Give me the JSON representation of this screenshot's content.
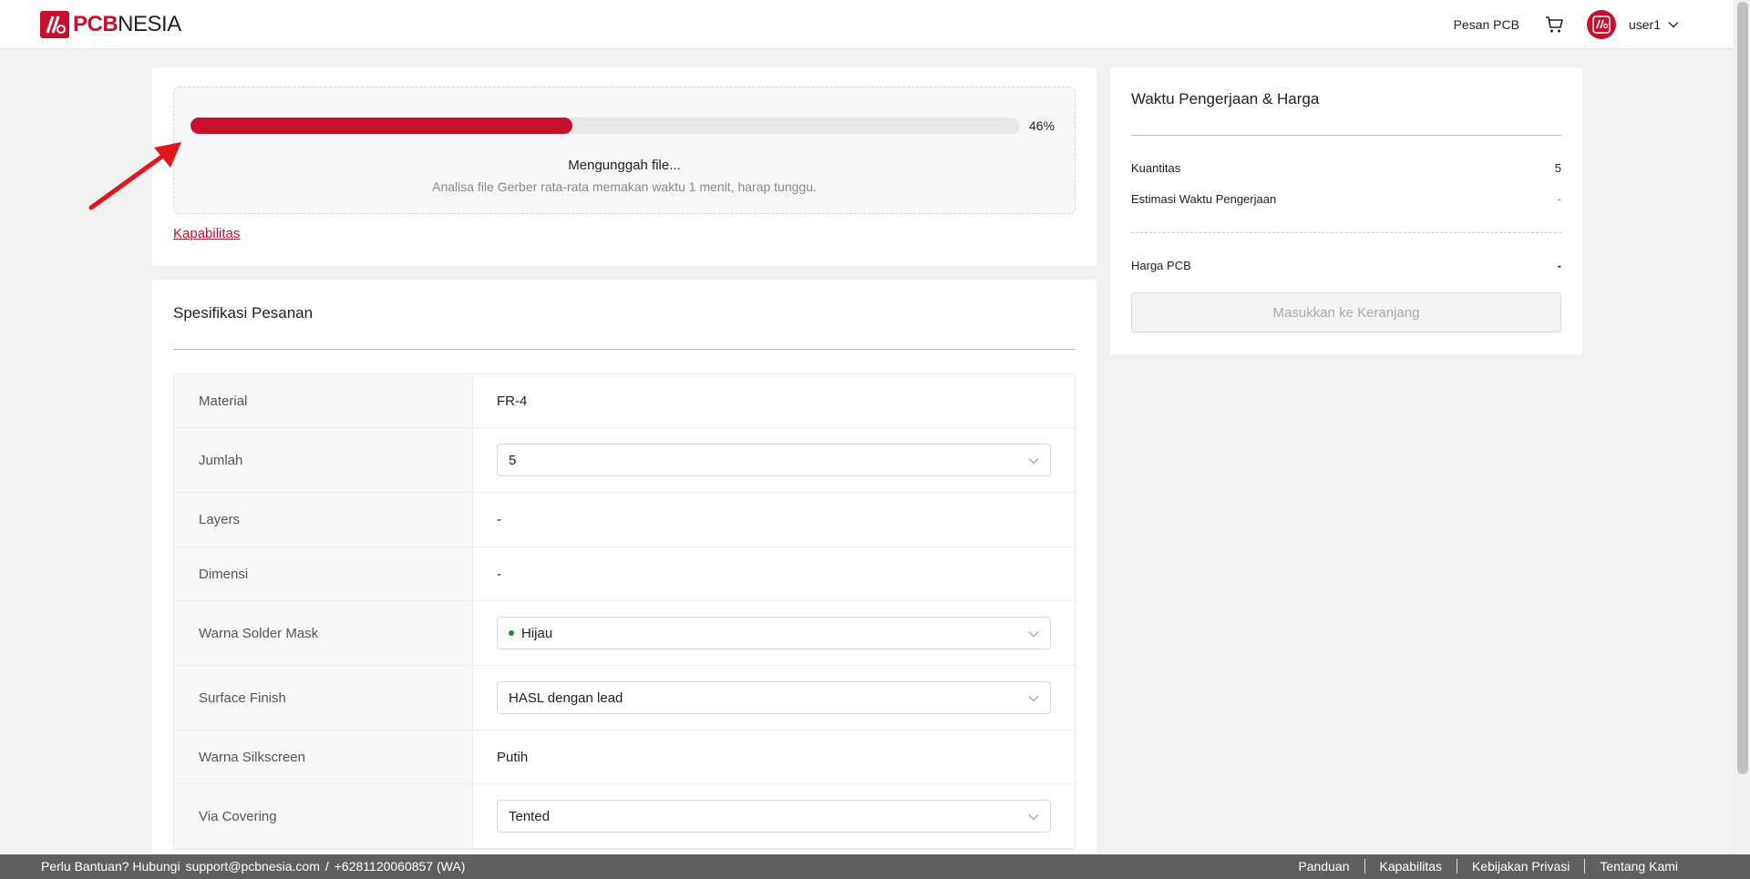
{
  "header": {
    "logo": {
      "brand_part1": "PCB",
      "brand_part2": "NESIA"
    },
    "nav": {
      "order_pcb": "Pesan PCB"
    },
    "user": {
      "name": "user1"
    }
  },
  "upload": {
    "progress_percent": 46,
    "progress_label": "46%",
    "title": "Mengunggah file...",
    "subtitle": "Analisa file Gerber rata-rata memakan waktu 1 menit, harap tunggu.",
    "capabilities_link": "Kapabilitas"
  },
  "spec": {
    "title": "Spesifikasi Pesanan",
    "rows": [
      {
        "label": "Material",
        "value": "FR-4",
        "type": "text"
      },
      {
        "label": "Jumlah",
        "value": "5",
        "type": "select"
      },
      {
        "label": "Layers",
        "value": "-",
        "type": "text"
      },
      {
        "label": "Dimensi",
        "value": "-",
        "type": "text"
      },
      {
        "label": "Warna Solder Mask",
        "value": "Hijau",
        "type": "select",
        "dot_color": "#1a8f2a"
      },
      {
        "label": "Surface Finish",
        "value": "HASL dengan lead",
        "type": "select"
      },
      {
        "label": "Warna Silkscreen",
        "value": "Putih",
        "type": "text"
      },
      {
        "label": "Via Covering",
        "value": "Tented",
        "type": "select"
      }
    ]
  },
  "price": {
    "title": "Waktu Pengerjaan & Harga",
    "quantity_label": "Kuantitas",
    "quantity_value": "5",
    "estimate_label": "Estimasi Waktu Pengerjaan",
    "estimate_value": "-",
    "pcb_price_label": "Harga PCB",
    "pcb_price_value": "-",
    "add_to_cart": "Masukkan ke Keranjang"
  },
  "footer": {
    "help_text": "Perlu Bantuan? Hubungi",
    "email": "support@pcbnesia.com",
    "separator": "/",
    "phone": "+6281120060857 (WA)",
    "links": [
      "Panduan",
      "Kapabilitas",
      "Kebijakan Privasi",
      "Tentang Kami"
    ]
  },
  "colors": {
    "brand": "#c8102e",
    "annotation_arrow": "#e3141b",
    "footer_bg": "#5f5f5f"
  },
  "icons": {
    "cart": "cart-icon",
    "chevron": "chevron-down-icon",
    "arrow_annotation": "arrow-annotation-icon"
  }
}
